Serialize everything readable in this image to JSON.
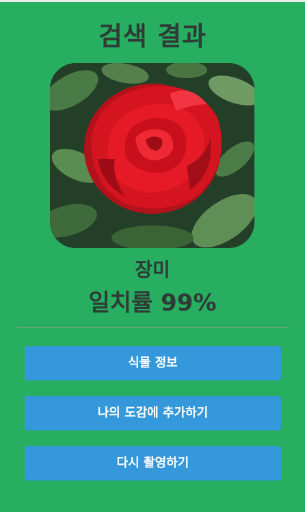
{
  "header": {
    "title": "검색 결과"
  },
  "result": {
    "plant_name": "장미",
    "match_text": "일치률 99%",
    "match_percent": 99
  },
  "actions": {
    "plant_info_label": "식물 정보",
    "add_to_collection_label": "나의 도감에 추가하기",
    "retake_label": "다시 촬영하기"
  },
  "colors": {
    "background": "#27ae60",
    "button": "#3498db",
    "text_dark": "#2f3a36",
    "button_text": "#ffffff"
  }
}
